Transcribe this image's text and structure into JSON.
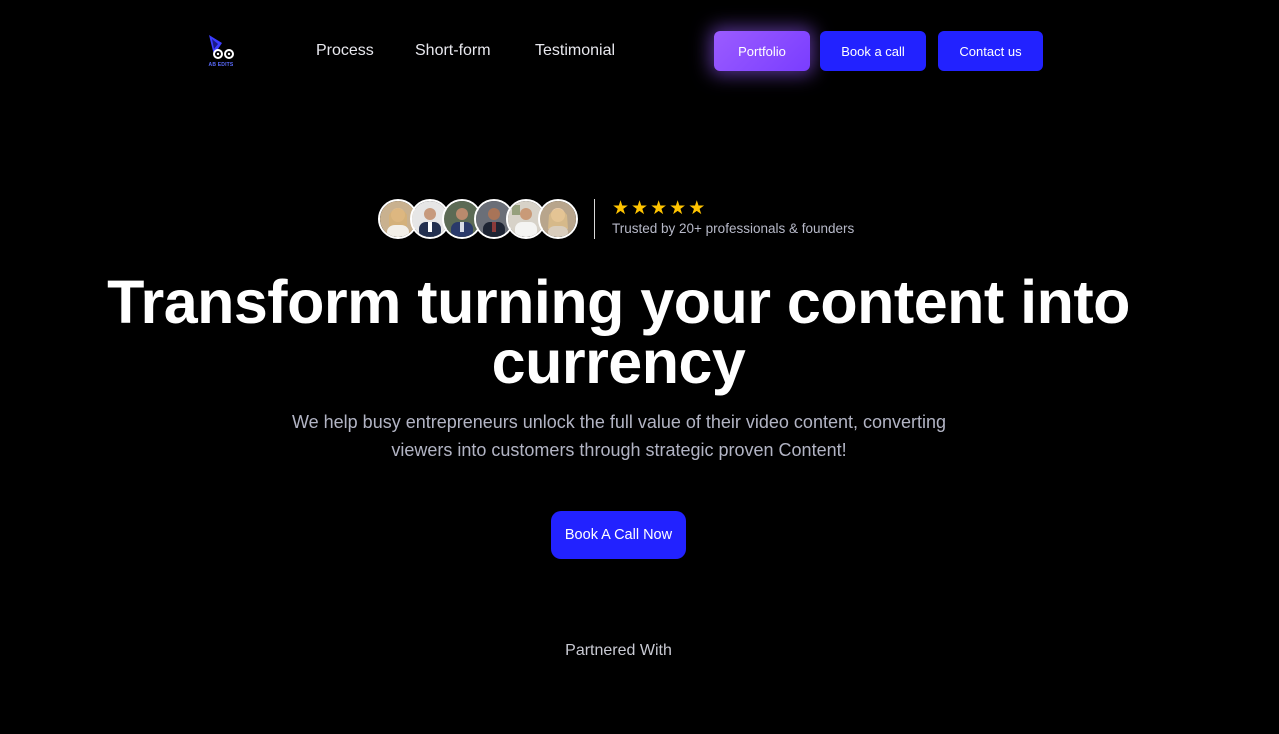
{
  "brand": {
    "logo_text": "AB EDITS",
    "logo_icon": "ab-edits-logo-icon"
  },
  "nav": {
    "links": [
      {
        "label": "Process"
      },
      {
        "label": "Short-form"
      },
      {
        "label": "Testimonial"
      }
    ],
    "buttons": {
      "portfolio": "Portfolio",
      "book": "Book a call",
      "contact": "Contact us"
    }
  },
  "trust": {
    "avatars": [
      "avatar-1",
      "avatar-2",
      "avatar-3",
      "avatar-4",
      "avatar-5",
      "avatar-6"
    ],
    "stars": [
      "★",
      "★",
      "★",
      "★",
      "★"
    ],
    "rating": 5,
    "text": "Trusted by 20+ professionals & founders"
  },
  "hero": {
    "title_line1": "Transform turning your content into",
    "title_line2": "currency",
    "subtitle_line1": "We help busy entrepreneurs unlock the full value of their video content, converting",
    "subtitle_line2": "viewers into customers through strategic proven Content!",
    "cta": "Book A Call Now"
  },
  "partners": {
    "heading": "Partnered With"
  },
  "colors": {
    "background": "#000000",
    "primary": "#2222ff",
    "portfolio_gradient_start": "#9b5cff",
    "star": "#ffc400",
    "muted_text": "#b2b4c4"
  }
}
